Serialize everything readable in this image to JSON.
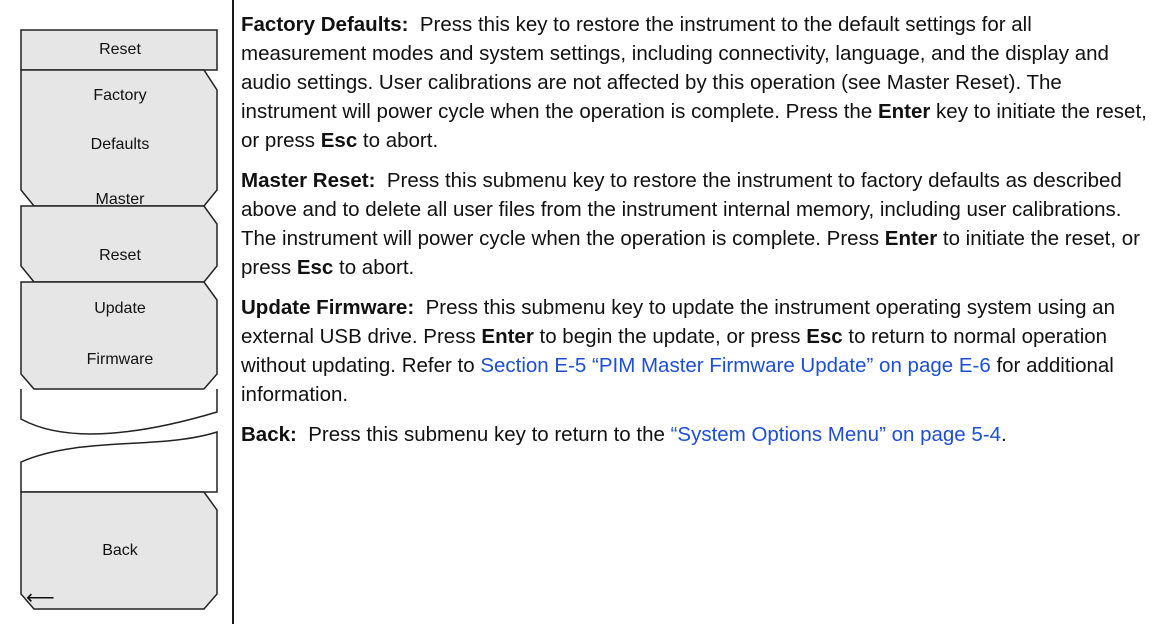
{
  "menu": {
    "title": "Reset",
    "keys": [
      {
        "line1": "Factory",
        "line2": "Defaults"
      },
      {
        "line1": "Master",
        "line2": "Reset"
      },
      {
        "line1": "Update",
        "line2": "Firmware"
      }
    ],
    "back_label": "Back",
    "back_arrow": "⟵"
  },
  "sections": {
    "factory": {
      "term": "Factory Defaults:",
      "t1": "Press this key to restore the instrument to the default settings for all measurement modes and system settings, including connectivity, language, and the display and audio settings. User calibrations are not affected by this operation (see Master Reset). The instrument will power cycle when the operation is complete. Press the ",
      "b1": "Enter",
      "t2": " key to initiate the reset, or press ",
      "b2": "Esc",
      "t3": " to abort."
    },
    "master": {
      "term": "Master Reset:",
      "t1": "Press this submenu key to restore the instrument to factory defaults as described above and to delete all user files from the instrument internal memory, including user calibrations. The instrument will power cycle when the operation is complete. Press ",
      "b1": "Enter",
      "t2": " to initiate the reset, or press ",
      "b2": "Esc",
      "t3": " to abort."
    },
    "update": {
      "term": "Update Firmware:",
      "t1": "Press this submenu key to update the instrument operating system using an external USB drive. Press ",
      "b1": "Enter",
      "t2": " to begin the update, or press ",
      "b2": "Esc",
      "t3": " to return to normal operation without updating. Refer to ",
      "link": "Section E-5 “PIM Master Firmware Update” on page E-6",
      "t4": " for additional information."
    },
    "back": {
      "term": "Back:",
      "t1": "Press this submenu key to return to the ",
      "link": "“System Options Menu” on page 5-4",
      "t2": "."
    }
  },
  "colors": {
    "link": "#1d4fd6",
    "key_fill": "#e6e6e6",
    "key_edge": "#222222"
  }
}
